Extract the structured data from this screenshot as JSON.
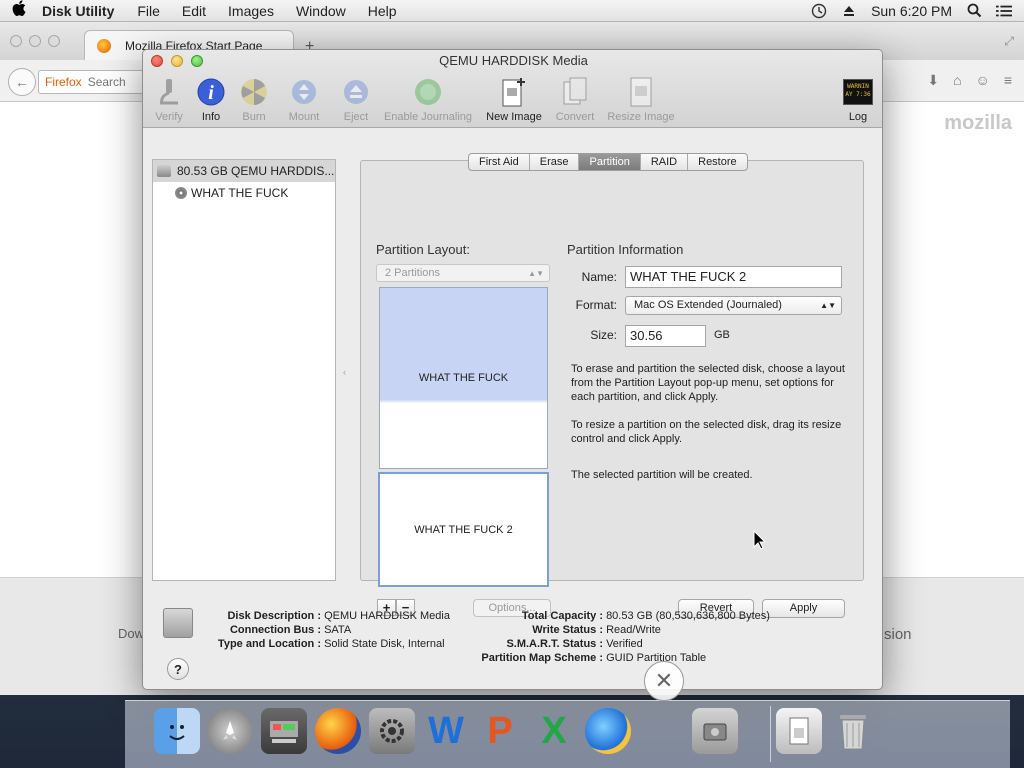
{
  "menubar": {
    "app_name": "Disk Utility",
    "items": [
      "File",
      "Edit",
      "Images",
      "Window",
      "Help"
    ],
    "clock": "Sun 6:20 PM"
  },
  "firefox": {
    "tab_title": "Mozilla Firefox Start Page",
    "url_label": "Firefox",
    "search_placeholder": "Search",
    "brand": "mozilla",
    "lower_left_text": "Dow",
    "lower_right_text": "sion"
  },
  "window": {
    "title": "QEMU HARDDISK Media"
  },
  "toolbar": {
    "verify": "Verify",
    "info": "Info",
    "burn": "Burn",
    "mount": "Mount",
    "eject": "Eject",
    "enable_journaling": "Enable Journaling",
    "new_image": "New Image",
    "convert": "Convert",
    "resize_image": "Resize Image",
    "log": "Log",
    "log_badge": "WARNIN\nAY 7:36"
  },
  "sidebar": {
    "disk": "80.53 GB QEMU HARDDIS...",
    "volume": "WHAT THE FUCK"
  },
  "tabs": [
    "First Aid",
    "Erase",
    "Partition",
    "RAID",
    "Restore"
  ],
  "partition": {
    "layout_label": "Partition Layout:",
    "layout_value": "2 Partitions",
    "part1": "WHAT THE FUCK",
    "part2": "WHAT THE FUCK 2",
    "plus": "+",
    "minus": "−",
    "options": "Options...",
    "info_label": "Partition Information",
    "name_label": "Name:",
    "name_value": "WHAT THE FUCK 2",
    "format_label": "Format:",
    "format_value": "Mac OS Extended (Journaled)",
    "size_label": "Size:",
    "size_value": "30.56",
    "size_unit": "GB",
    "help1": "To erase and partition the selected disk, choose a layout from the Partition Layout pop-up menu, set options for each partition, and click Apply.",
    "help2": "To resize a partition on the selected disk, drag its resize control and click Apply.",
    "help3": "The selected partition will be created.",
    "revert": "Revert",
    "apply": "Apply"
  },
  "info": {
    "disk_description_k": "Disk Description :",
    "disk_description_v": "QEMU HARDDISK Media",
    "connection_bus_k": "Connection Bus :",
    "connection_bus_v": "SATA",
    "type_location_k": "Type and Location :",
    "type_location_v": "Solid State Disk, Internal",
    "total_capacity_k": "Total Capacity :",
    "total_capacity_v": "80.53 GB (80,530,636,800 Bytes)",
    "write_status_k": "Write Status :",
    "write_status_v": "Read/Write",
    "smart_status_k": "S.M.A.R.T. Status :",
    "smart_status_v": "Verified",
    "partition_map_k": "Partition Map Scheme :",
    "partition_map_v": "GUID Partition Table",
    "help": "?"
  },
  "dock": {
    "word_letter": "W",
    "ppt_letter": "P",
    "excel_letter": "X"
  }
}
